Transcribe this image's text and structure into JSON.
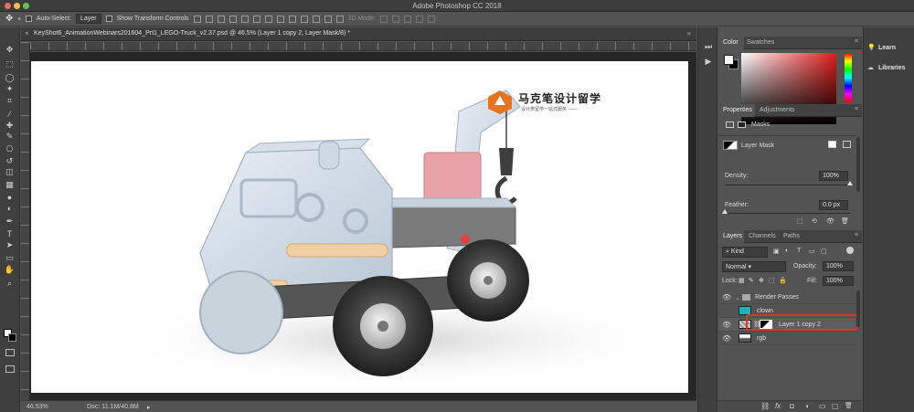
{
  "app": {
    "title": "Adobe Photoshop CC 2018"
  },
  "options_bar": {
    "auto_select_label": "Auto-Select:",
    "auto_select_value": "Layer",
    "transform_label": "Show Transform Controls",
    "mode_3d_label": "3D Mode:"
  },
  "document": {
    "tab_title": "KeyShot6_AnimationWebinars201604_Prt1_LEGO-Truck_v2.37.psd @ 46.5% (Layer 1 copy 2, Layer Mask/8) *",
    "close_glyph": "×",
    "collapse_glyph": "»"
  },
  "logo": {
    "text": "马克笔设计留学",
    "subtext": "设计类留学一站式服务 ——",
    "color": "#e8731f"
  },
  "status": {
    "zoom": "46.53%",
    "doc_size": "Doc: 11.1M/40.8M"
  },
  "tools": {
    "icons": [
      "move-icon",
      "marquee-icon",
      "lasso-icon",
      "magic-wand-icon",
      "crop-icon",
      "eyedropper-icon",
      "healing-icon",
      "brush-icon",
      "stamp-icon",
      "history-brush-icon",
      "eraser-icon",
      "gradient-icon",
      "blur-icon",
      "dodge-icon",
      "pen-icon",
      "type-icon",
      "path-select-icon",
      "shape-icon",
      "hand-icon",
      "zoom-icon"
    ],
    "glyphs": [
      "✥",
      "⬚",
      "◯",
      "✦",
      "⌗",
      "⁄",
      "✚",
      "✎",
      "⎔",
      "↺",
      "◫",
      "▦",
      "●",
      "◐",
      "✒",
      "T",
      "➤",
      "▭",
      "✋",
      "⌕"
    ]
  },
  "dock": {
    "glyphs": [
      "⏭",
      "▶"
    ]
  },
  "color_panel": {
    "tabs": [
      "Color",
      "Swatches"
    ],
    "foreground": "#ffffff",
    "background": "#000000",
    "hue": "#e01b1b"
  },
  "properties_panel": {
    "tabs": [
      "Properties",
      "Adjustments"
    ],
    "masks_label": "Masks",
    "layer_mask_label": "Layer Mask",
    "density_label": "Density:",
    "density_value": "100%",
    "density_level": 100,
    "feather_label": "Feather:",
    "feather_value": "0.0 px",
    "feather_level": 0
  },
  "layers_panel": {
    "tabs": [
      "Layers",
      "Channels",
      "Paths"
    ],
    "filter_kind": "Kind",
    "blend_mode": "Normal",
    "opacity_label": "Opacity:",
    "opacity_value": "100%",
    "lock_label": "Lock:",
    "fill_label": "Fill:",
    "fill_value": "100%",
    "layers": [
      {
        "name": "Render Passes",
        "type": "group"
      },
      {
        "name": "clown",
        "type": "layer"
      },
      {
        "name": "Layer 1 copy 2",
        "type": "layer",
        "selected": true
      },
      {
        "name": "rgb",
        "type": "layer"
      }
    ],
    "bottom_icons": [
      "⛓",
      "fx",
      "◘",
      "◑",
      "▭",
      "▢",
      "🗑"
    ]
  },
  "right_column": {
    "learn": "Learn",
    "libraries": "Libraries"
  },
  "colors": {
    "selection_outline": "#e0341f"
  }
}
